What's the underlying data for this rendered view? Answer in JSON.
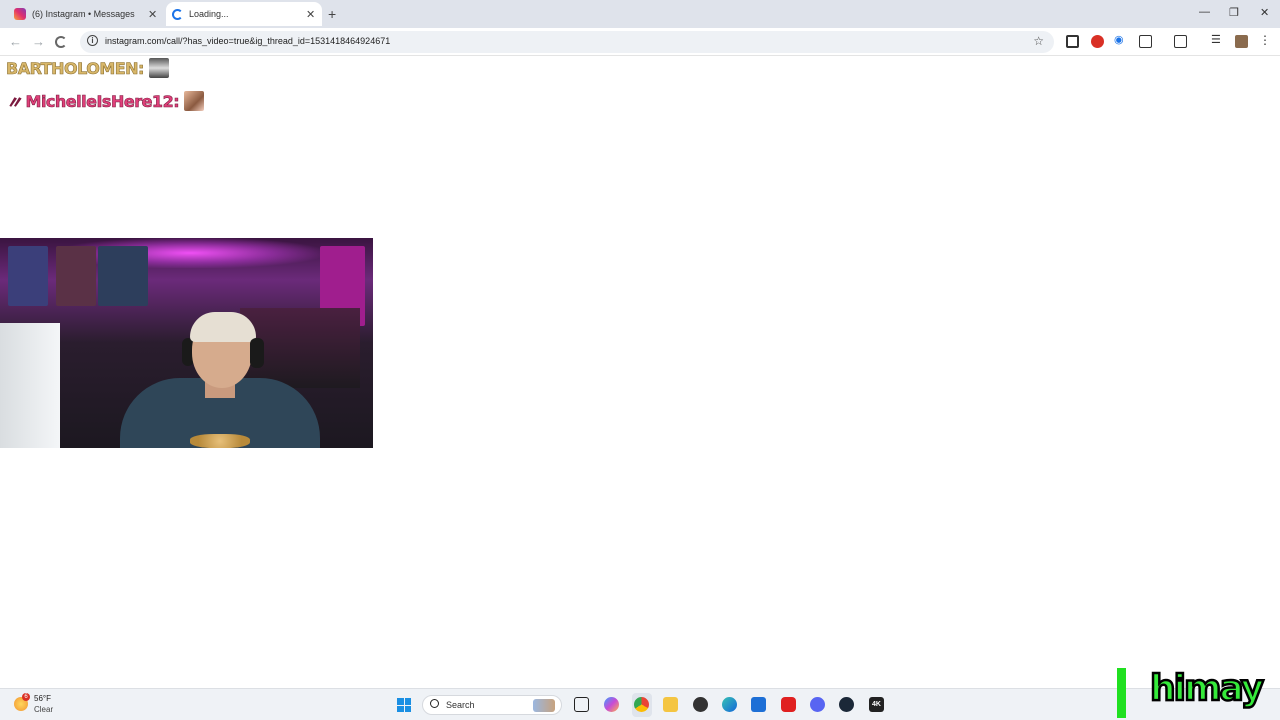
{
  "browser": {
    "tabs": [
      {
        "label": "(6) Instagram • Messages",
        "icon": "instagram-icon",
        "active": false
      },
      {
        "label": "Loading...",
        "icon": "loading-spinner-icon",
        "active": true
      }
    ],
    "address_bar": {
      "url": "instagram.com/call/?has_video=true&ig_thread_id=1531418464924671"
    }
  },
  "page": {
    "alerts": [
      {
        "username": "BARTHOLOMEN:",
        "color": "#d8b76a"
      },
      {
        "badge": "〃",
        "username": "MichelleIsHere12:",
        "color": "#e0407a"
      }
    ],
    "video": {
      "description_icon": "webcam-video"
    }
  },
  "taskbar": {
    "weather": {
      "badge": "6",
      "temperature": "56°F",
      "condition": "Clear"
    },
    "search_label": "Search",
    "accent": "#1a8fe3"
  },
  "overlay": {
    "logo_text": "himay",
    "color": "#35ea3a"
  }
}
